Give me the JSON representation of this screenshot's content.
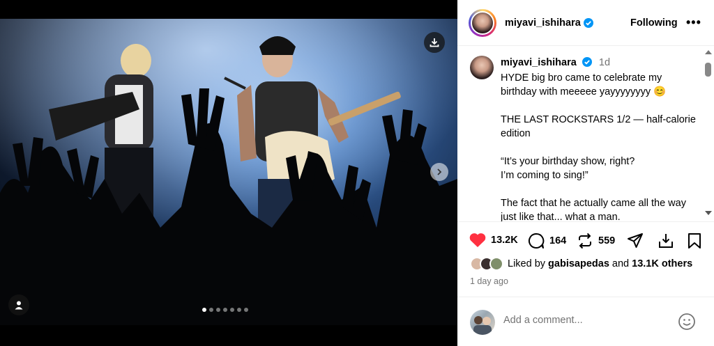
{
  "post": {
    "username": "miyavi_ishihara",
    "follow_status": "Following",
    "more_label": "•••"
  },
  "caption": {
    "username": "miyavi_ishihara",
    "time": "1d",
    "paragraphs": [
      "HYDE big bro came to celebrate my birthday with meeeee yayyyyyyyy 😊",
      "THE LAST ROCKSTARS 1/2 — half-calorie edition",
      "“It’s your birthday show, right?\nI’m coming to sing!”",
      "The fact that he actually came all the way just like that... what a man."
    ]
  },
  "actions": {
    "likes": "13.2K",
    "comments": "164",
    "reposts": "559"
  },
  "liked_by": {
    "prefix": "Liked by ",
    "user": "gabisapedas",
    "middle": " and ",
    "others": "13.1K others"
  },
  "posted_ago": "1 day ago",
  "comment_box": {
    "placeholder": "Add a comment..."
  },
  "carousel": {
    "total": 7,
    "active_index": 0
  },
  "colors": {
    "like_red": "#ff3040",
    "verified_blue": "#0095f6",
    "muted_text": "#737373"
  }
}
